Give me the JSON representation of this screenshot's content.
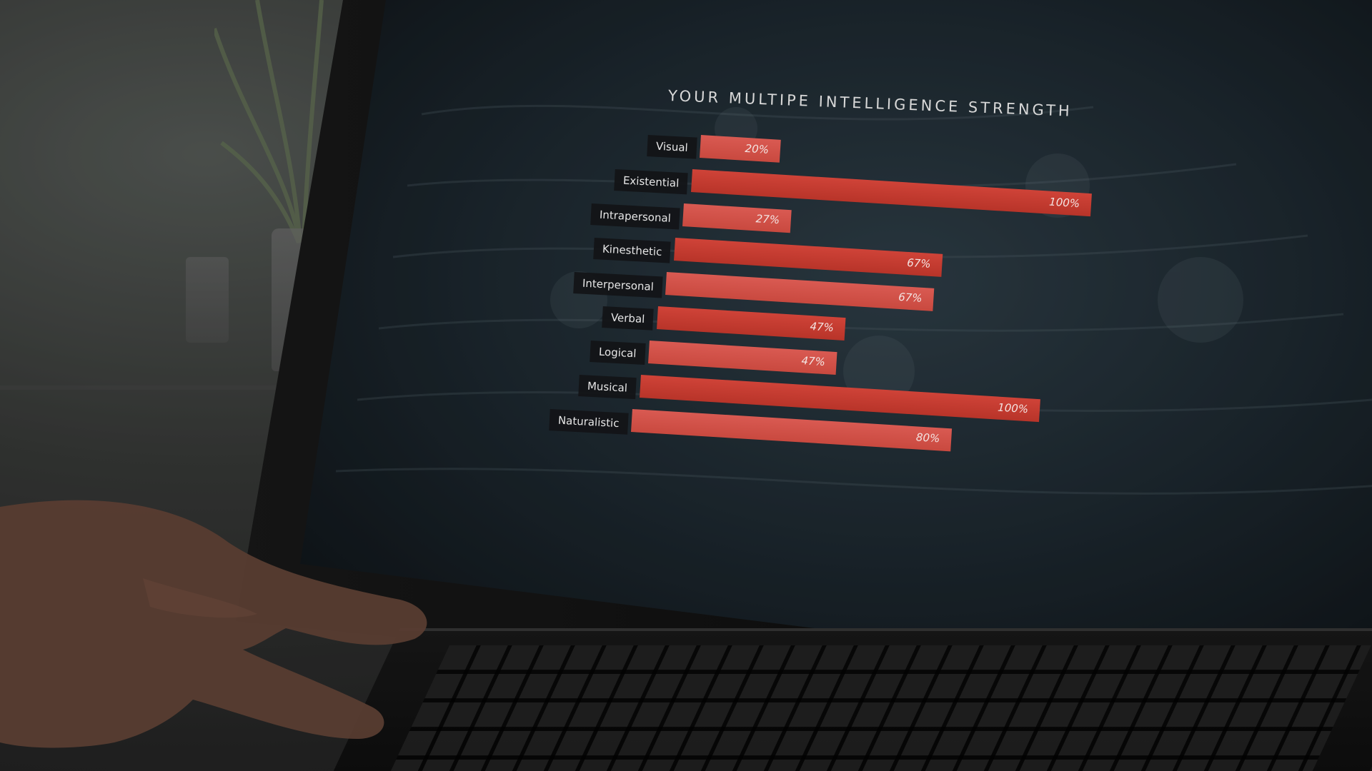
{
  "colors": {
    "bar_primary": "#d95a52",
    "bar_secondary": "#c9493f",
    "screen_bg": "#1a232b",
    "label_bg": "#121417",
    "text": "#e7e7e7"
  },
  "chart_data": {
    "type": "bar",
    "title": "YOUR MULTIPE INTELLIGENCE STRENGTH",
    "xlabel": "",
    "ylabel": "",
    "xlim": [
      0,
      100
    ],
    "categories": [
      "Visual",
      "Existential",
      "Intrapersonal",
      "Kinesthetic",
      "Interpersonal",
      "Verbal",
      "Logical",
      "Musical",
      "Naturalistic"
    ],
    "values": [
      20,
      100,
      27,
      67,
      67,
      47,
      47,
      100,
      80
    ],
    "value_labels": [
      "20%",
      "100%",
      "27%",
      "67%",
      "67%",
      "47%",
      "47%",
      "100%",
      "80%"
    ],
    "orientation": "horizontal",
    "grid": false,
    "legend": "none"
  }
}
